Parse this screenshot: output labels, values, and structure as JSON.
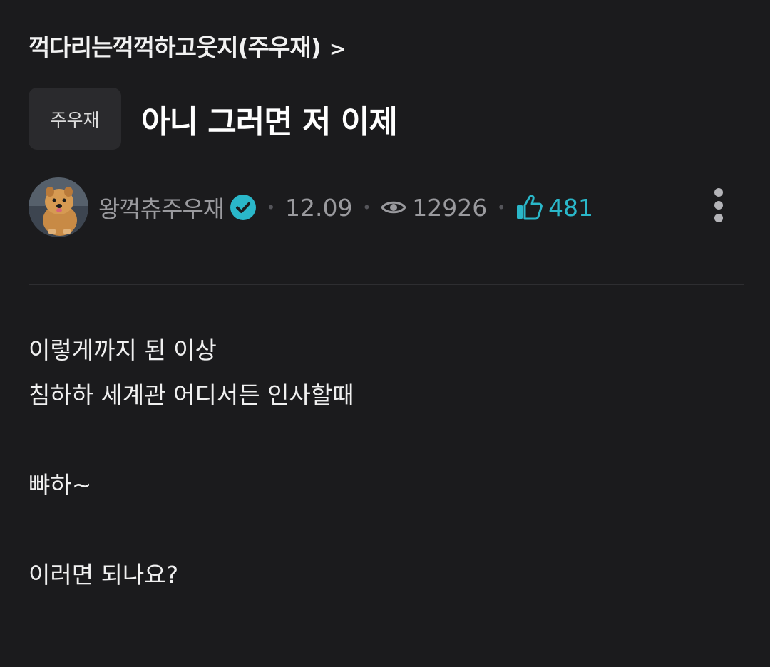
{
  "board": {
    "name": "꺽다리는꺽꺽하고웃지(주우재)",
    "chevron": ">"
  },
  "post": {
    "tag": "주우재",
    "title": "아니 그러면 저 이제",
    "author": "왕꺽츄주우재",
    "date": "12.09",
    "views": "12926",
    "likes": "481",
    "body": [
      "이렇게까지 된 이상",
      "침하하 세계관 어디서든 인사할때",
      "",
      "뺘하~",
      "",
      "이러면 되나요?"
    ]
  },
  "icons": {
    "verified": "verified-check-icon",
    "views": "eye-icon",
    "likes": "thumbs-up-icon",
    "more": "more-vertical-icon"
  },
  "colors": {
    "background": "#1b1b1d",
    "accent": "#2ab7c9",
    "muted_text": "#9a9a9e",
    "tag_background": "#2a2a2d"
  }
}
